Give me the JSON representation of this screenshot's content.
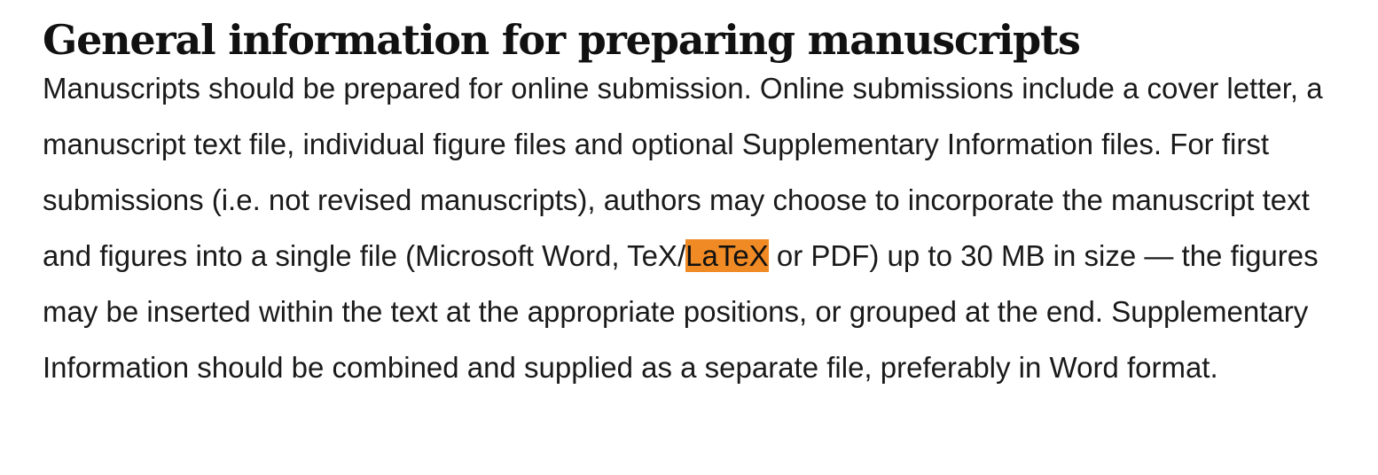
{
  "heading": "General information for preparing manuscripts",
  "paragraph": {
    "before_highlight": "Manuscripts should be prepared for online submission. Online submissions include a cover letter, a manuscript text file, individual figure files and optional Supplementary Information files. For first submissions (i.e. not revised manuscripts), authors may choose to incorporate the manuscript text and figures into a single file (Microsoft Word, TeX/",
    "highlighted": "LaTeX",
    "after_highlight": " or PDF) up to 30 MB in size — the figures may be inserted within the text at the appropriate positions, or grouped at the end. Supplementary Information should be combined and supplied as a separate file, preferably in Word format."
  },
  "colors": {
    "highlight": "#f08a24",
    "text": "#1a1a1a",
    "background": "#ffffff"
  }
}
